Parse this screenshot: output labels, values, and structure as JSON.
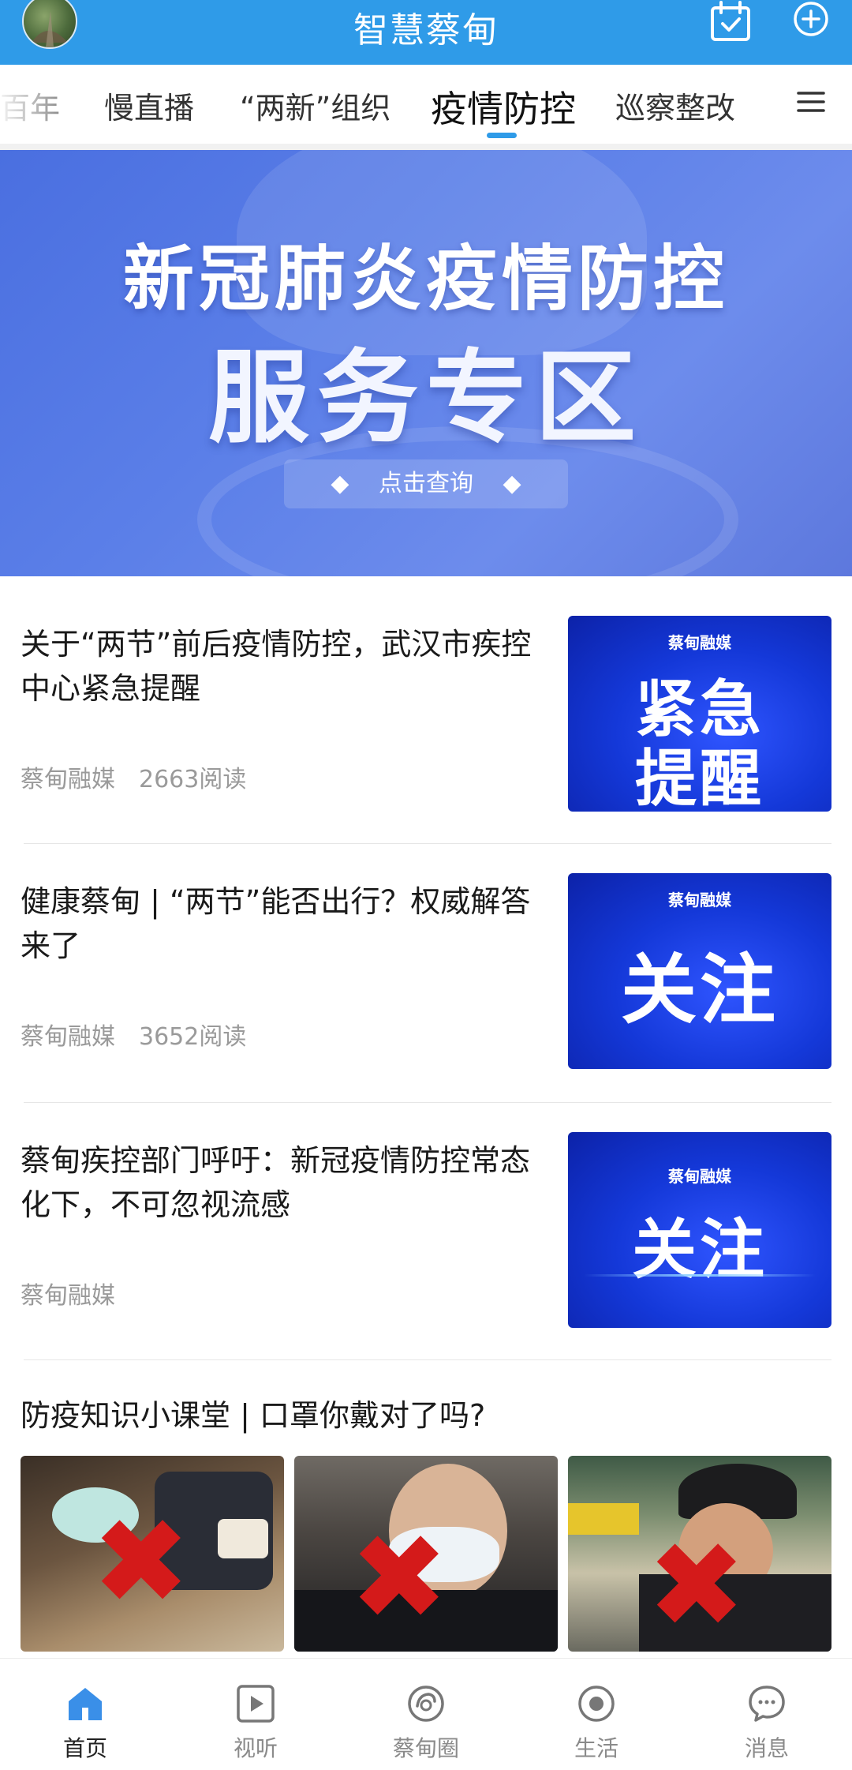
{
  "header": {
    "title": "智慧蔡甸",
    "icons": [
      "avatar",
      "calendar-check-icon",
      "plus-circle-icon"
    ],
    "background_color": "#2f9be8"
  },
  "tabs": {
    "items": [
      "百年",
      "慢直播",
      "“两新”组织",
      "疫情防控",
      "巡察整改"
    ],
    "active": "疫情防控",
    "menu_icon": "menu-icon"
  },
  "banner": {
    "line1": "新冠肺炎疫情防控",
    "line2": "服务专区",
    "button": "点击查询"
  },
  "news": [
    {
      "title": "关于“两节”前后疫情防控，武汉市疾控中心紧急提醒",
      "source": "蔡甸融媒",
      "reads": "2663阅读",
      "thumb_brand": "蔡甸融媒",
      "thumb_text_1": "紧急",
      "thumb_text_2": "提醒"
    },
    {
      "title": "健康蔡甸 | “两节”能否出行？权威解答来了",
      "source": "蔡甸融媒",
      "reads": "3652阅读",
      "thumb_brand": "蔡甸融媒",
      "thumb_text_1": "关注"
    },
    {
      "title": "蔡甸疾控部门呼吁：新冠疫情防控常态化下，不可忽视流感",
      "source": "蔡甸融媒",
      "thumb_brand": "蔡甸融媒",
      "thumb_text_1": "关注"
    }
  ],
  "knowledge": {
    "title": "防疫知识小课堂 | 口罩你戴对了吗?"
  },
  "bottom_nav": [
    {
      "label": "首页",
      "icon": "home-icon",
      "active": true
    },
    {
      "label": "视听",
      "icon": "video-play-icon",
      "active": false
    },
    {
      "label": "蔡甸圈",
      "icon": "circle-swirl-icon",
      "active": false
    },
    {
      "label": "生活",
      "icon": "life-circle-icon",
      "active": false
    },
    {
      "label": "消息",
      "icon": "chat-bubble-icon",
      "active": false
    }
  ],
  "colors": {
    "accent": "#2f9be8",
    "thumb_blue": "#1438d8",
    "cross_red": "#d41a1a"
  }
}
